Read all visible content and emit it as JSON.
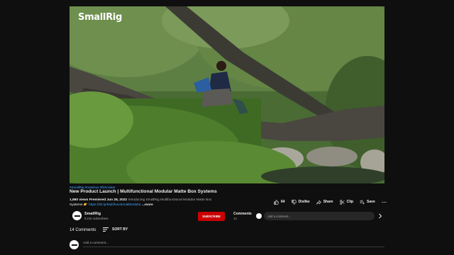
{
  "player": {
    "brand": "SmallRig"
  },
  "video": {
    "hashtags": "#SmallRig #matebox #filmmaker",
    "title": "New Product Launch | Multifunctional Modular Matte Box Systems",
    "views": "1,980 views",
    "premiered": "Premiered Jun 28, 2022",
    "description_line1": "Introducing SmallRig Multifunctional Modular Matte Box",
    "description_line2_prefix": "Systems 👉",
    "description_link": "https://bit.ly/MultifunctionalModular",
    "more_label": "...more"
  },
  "actions": {
    "like_count": "64",
    "dislike_label": "Dislike",
    "share_label": "Share",
    "clip_label": "Clip",
    "save_label": "Save",
    "more_icon": "more-horizontal-icon"
  },
  "channel": {
    "name": "SmallRig",
    "subscribers": "9.21K subscribers",
    "subscribe_label": "SUBSCRIBE"
  },
  "comments_teaser": {
    "label": "Comments",
    "count": "14",
    "placeholder": "Add a comment..."
  },
  "comments": {
    "count_label": "14 Comments",
    "sort_label": "SORT BY",
    "add_placeholder": "Add a comment..."
  },
  "colors": {
    "background": "#0f0f0f",
    "subscribe": "#cc0000",
    "link": "#3ea6ff"
  }
}
